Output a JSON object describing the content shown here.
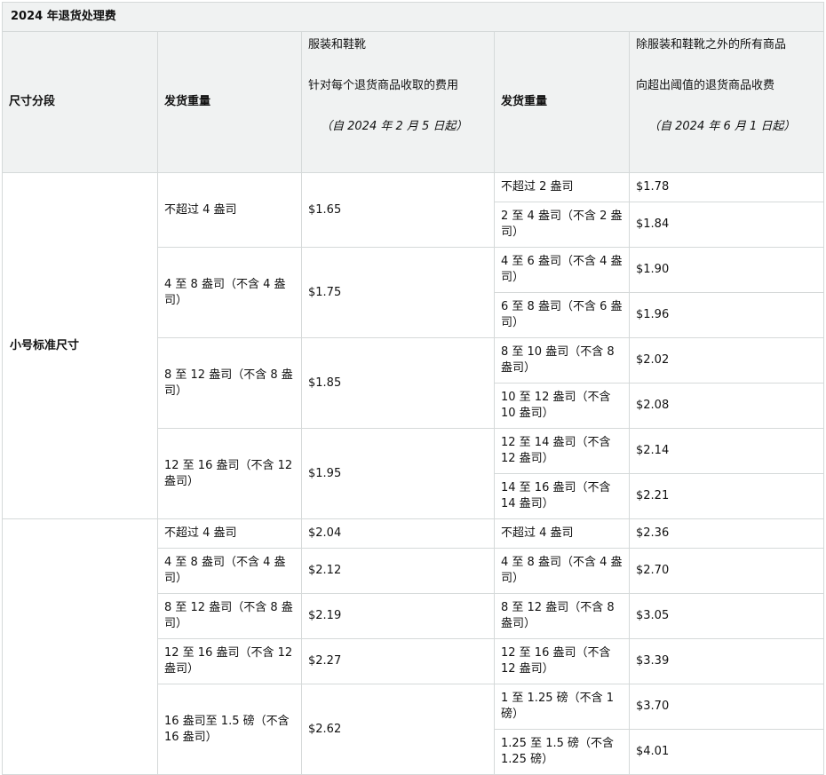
{
  "title": "2024 年退货处理费",
  "headers": {
    "size_tier": "尺寸分段",
    "weight_left": "发货重量",
    "apparel_lines": [
      "服装和鞋靴",
      "针对每个退货商品收取的费用",
      "（自 2024 年 2 月 5 日起）"
    ],
    "weight_right": "发货重量",
    "other_lines": [
      "除服装和鞋靴之外的所有商品",
      "向超出阈值的退货商品收费",
      "（自 2024 年 6 月 1 日起）"
    ]
  },
  "small_standard": {
    "tier": "小号标准尺寸",
    "groups": [
      {
        "weight": "不超过 4 盎司",
        "fee": "$1.65",
        "sub": [
          {
            "weight": "不超过 2 盎司",
            "fee": "$1.78"
          },
          {
            "weight": "2 至 4 盎司（不含 2 盎司）",
            "fee": "$1.84"
          }
        ]
      },
      {
        "weight": "4 至 8 盎司（不含 4 盎司）",
        "fee": "$1.75",
        "sub": [
          {
            "weight": "4 至 6 盎司（不含 4 盎司）",
            "fee": "$1.90"
          },
          {
            "weight": "6 至 8 盎司（不含 6 盎司）",
            "fee": "$1.96"
          }
        ]
      },
      {
        "weight": "8 至 12 盎司（不含 8 盎司）",
        "fee": "$1.85",
        "sub": [
          {
            "weight": "8 至 10 盎司（不含 8 盎司）",
            "fee": "$2.02"
          },
          {
            "weight": "10 至 12 盎司（不含 10 盎司）",
            "fee": "$2.08"
          }
        ]
      },
      {
        "weight": "12 至 16 盎司（不含 12 盎司）",
        "fee": "$1.95",
        "sub": [
          {
            "weight": "12 至 14 盎司（不含 12 盎司）",
            "fee": "$2.14"
          },
          {
            "weight": "14 至 16 盎司（不含 14 盎司）",
            "fee": "$2.21"
          }
        ]
      }
    ]
  },
  "large_standard": {
    "tier": "",
    "rows": [
      {
        "weight_left": "不超过 4 盎司",
        "fee_left": "$2.04",
        "weight_right": "不超过 4 盎司",
        "fee_right": "$2.36"
      },
      {
        "weight_left": "4 至 8 盎司（不含 4 盎司）",
        "fee_left": "$2.12",
        "weight_right": "4 至 8 盎司（不含 4 盎司）",
        "fee_right": "$2.70"
      },
      {
        "weight_left": "8 至 12 盎司（不含 8 盎司）",
        "fee_left": "$2.19",
        "weight_right": "8 至 12 盎司（不含 8 盎司）",
        "fee_right": "$3.05"
      },
      {
        "weight_left": "12 至 16 盎司（不含 12 盎司）",
        "fee_left": "$2.27",
        "weight_right": "12 至 16 盎司（不含 12 盎司）",
        "fee_right": "$3.39"
      }
    ],
    "group": {
      "weight": "16 盎司至 1.5 磅（不含 16 盎司）",
      "fee": "$2.62",
      "sub": [
        {
          "weight": "1 至 1.25 磅（不含 1 磅）",
          "fee": "$3.70"
        },
        {
          "weight": "1.25 至 1.5 磅（不含 1.25 磅）",
          "fee": "$4.01"
        }
      ]
    }
  }
}
